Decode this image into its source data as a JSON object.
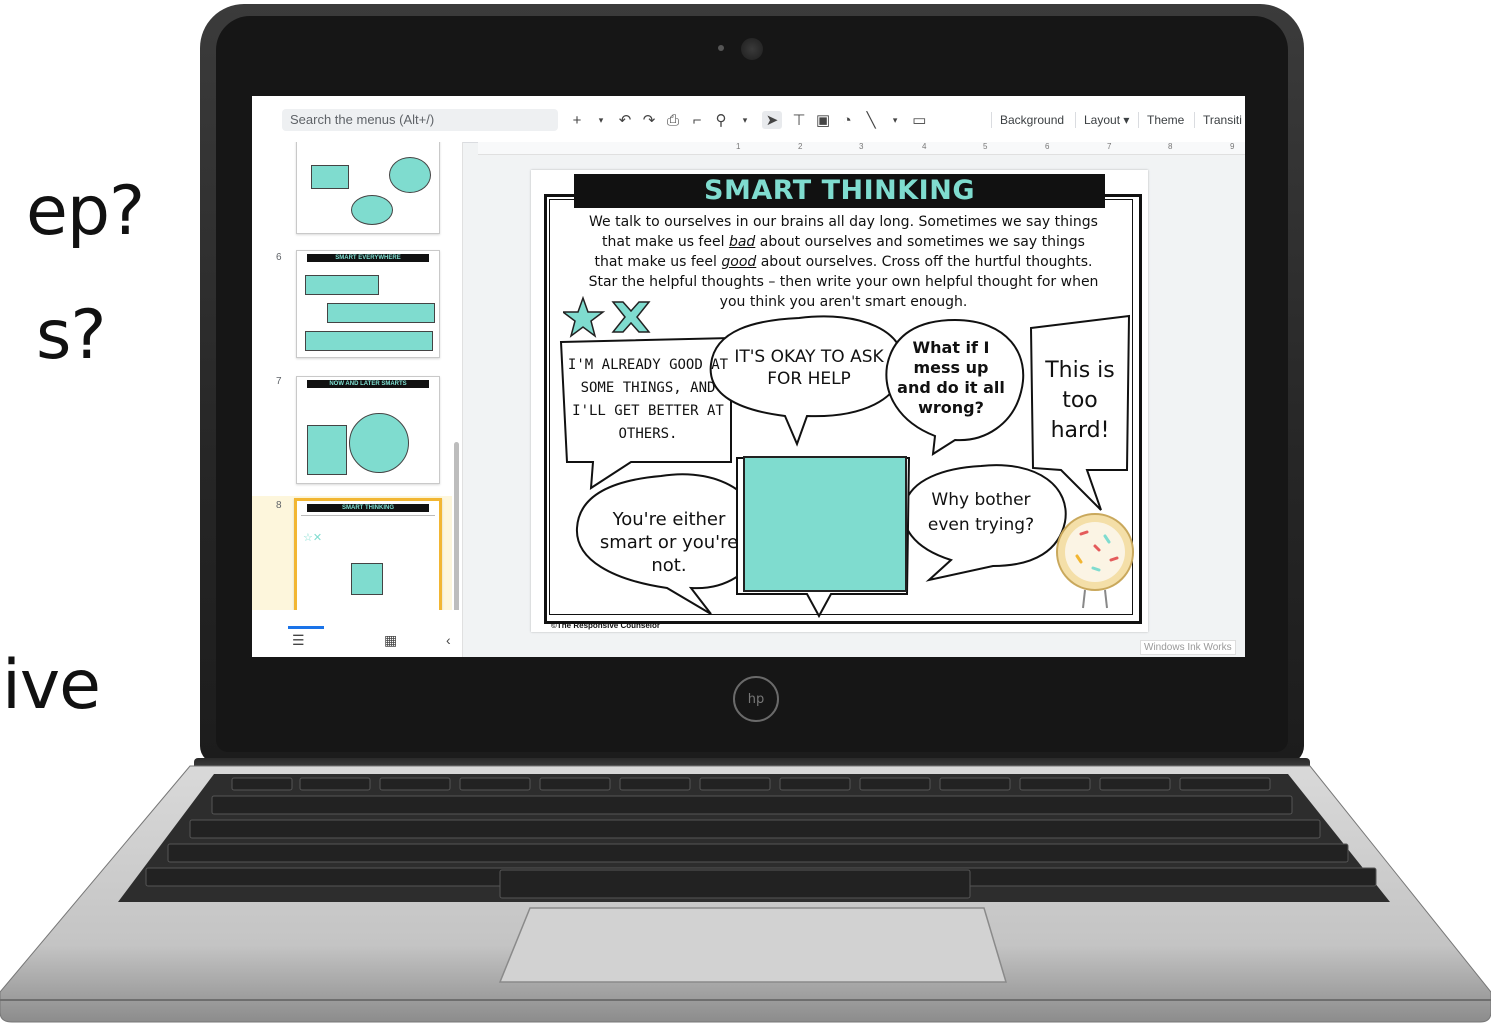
{
  "background_text": [
    "ep?",
    "s?",
    "ive"
  ],
  "toolbar": {
    "search_placeholder": "Search the menus (Alt+/)",
    "background_label": "Background",
    "layout_label": "Layout",
    "theme_label": "Theme",
    "transition_label": "Transiti"
  },
  "filmstrip": {
    "slides": [
      {
        "number": "6",
        "title": "SMART EVERYWHERE"
      },
      {
        "number": "7",
        "title": "NOW AND LATER SMARTS"
      },
      {
        "number": "8",
        "title": "SMART THINKING",
        "selected": true
      }
    ]
  },
  "ruler": [
    "1",
    "2",
    "3",
    "4",
    "5",
    "6",
    "7",
    "8",
    "9"
  ],
  "slide": {
    "title": "SMART THINKING",
    "intro_1": "We talk to ourselves in our brains all day long. Sometimes we say things",
    "intro_2a": "that make us feel ",
    "intro_2b": "bad",
    "intro_2c": " about ourselves and sometimes we say things",
    "intro_3a": "that make us feel ",
    "intro_3b": "good",
    "intro_3c": " about ourselves. Cross off the hurtful thoughts.",
    "intro_4": "Star the helpful thoughts – then write your own helpful thought for when",
    "intro_5": "you think you aren't smart enough.",
    "bubbles": {
      "already_good": "I'M ALREADY GOOD AT SOME THINGS, AND I'LL GET BETTER AT OTHERS.",
      "ask_help": "IT'S OKAY TO ASK FOR HELP",
      "mess_up": "What if I mess up and do it all wrong?",
      "too_hard": "This is too hard!",
      "either_smart": "You're either smart or you're not.",
      "why_bother": "Why bother even trying?"
    },
    "credit": "©The Responsive Counselor"
  },
  "overlay": {
    "ink_label": "Windows Ink Works"
  },
  "colors": {
    "teal": "#7fdccf",
    "selection": "#f2b632",
    "accent_blue": "#1a73e8"
  }
}
